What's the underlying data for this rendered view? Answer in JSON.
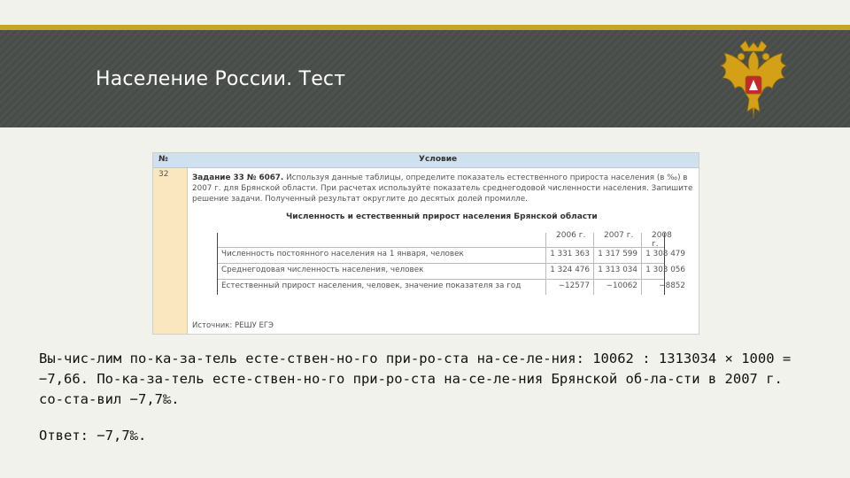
{
  "slide": {
    "title": "Население России. Тест",
    "colors": {
      "header_bg": "#4a4f4b",
      "accent": "#c9a227",
      "background": "#f2f2ec"
    },
    "emblem_icon": "russian-coat-of-arms-icon"
  },
  "task": {
    "header_no": "№",
    "header_condition": "Условие",
    "number": "32",
    "text_bold": "Задание 33 № 6067.",
    "text": " Используя данные таблицы, определите показатель естественного прироста населения (в ‰) в 2007 г. для Брянской области. При расчетах используйте показатель среднегодовой численности населения. Запишите решение задачи. Полученный результат округлите до десятых долей промилле.",
    "table_title": "Численность и естественный прирост населения Брянской области",
    "columns": [
      "2006 г.",
      "2007 г.",
      "2008 г."
    ],
    "rows": [
      {
        "label": "Численность постоянного населения на 1 января, человек",
        "values": [
          "1 331 363",
          "1 317 599",
          "1 308 479"
        ]
      },
      {
        "label": "Среднегодовая численность населения, человек",
        "values": [
          "1 324 476",
          "1 313 034",
          "1 303 056"
        ]
      },
      {
        "label": "Естественный прирост населения, человек, значение показателя за год",
        "values": [
          "−12577",
          "−10062",
          "−8852"
        ]
      }
    ],
    "source": "Источник: РЕШУ ЕГЭ"
  },
  "solution": {
    "line1": "Вы-чис-лим по-ка-за-тель есте-ствен-но-го при-ро-ста на-се-ле-ния: 10062 : 1313034 × 1000 =",
    "line2": "−7,66. По-ка-за-тель есте-ствен-но-го при-ро-ста на-се-ле-ния Брянской об-ла-сти в 2007 г.",
    "line3": "со-ста-вил −7,7‰.",
    "answer": "Ответ: −7,7‰."
  }
}
